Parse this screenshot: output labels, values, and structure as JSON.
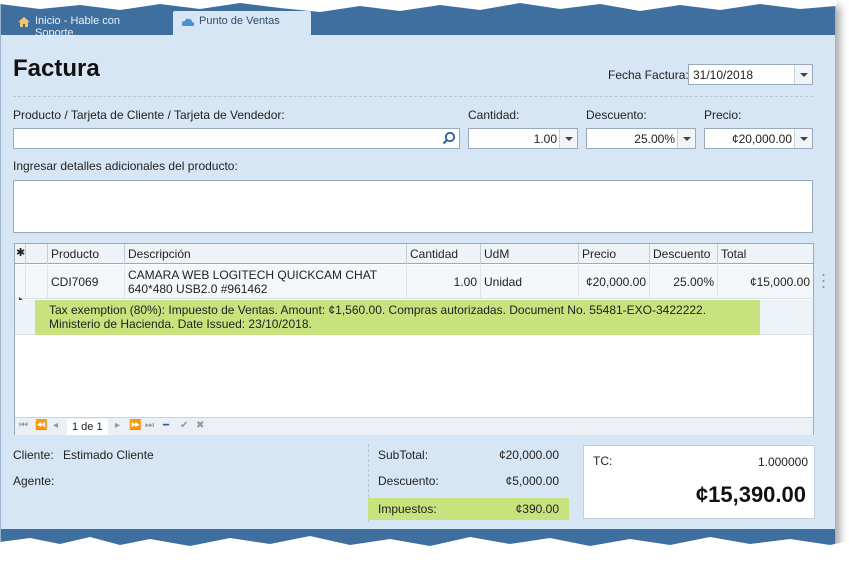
{
  "tabs": {
    "home_label": "Inicio - Hable con Soporte",
    "active_label": "Punto de Ventas"
  },
  "header": {
    "title": "Factura",
    "fecha_label": "Fecha Factura:",
    "fecha_value": "31/10/2018"
  },
  "form": {
    "producto_label": "Producto / Tarjeta de Cliente / Tarjeta de Vendedor:",
    "producto_value": "",
    "cantidad_label": "Cantidad:",
    "cantidad_value": "1.00",
    "descuento_label": "Descuento:",
    "descuento_value": "25.00%",
    "precio_label": "Precio:",
    "precio_value": "¢20,000.00",
    "detalles_label": "Ingresar detalles adicionales del producto:",
    "detalles_value": ""
  },
  "grid": {
    "corner_symbol": "✱",
    "columns": [
      "Producto",
      "Descripción",
      "Cantidad",
      "UdM",
      "Precio",
      "Descuento",
      "Total"
    ],
    "rows": [
      {
        "producto": "CDI7069",
        "descripcion": "CAMARA WEB LOGITECH QUICKCAM CHAT 640*480 USB2.0 #961462",
        "cantidad": "1.00",
        "udm": "Unidad",
        "precio": "¢20,000.00",
        "descuento": "25.00%",
        "total": "¢15,000.00",
        "detail": "Tax exemption (80%): Impuesto de Ventas. Amount: ¢1,560.00. Compras autorizadas. Document No. 55481-EXO-3422222. Ministerio de Hacienda. Date Issued: 23/10/2018."
      }
    ],
    "pager_text": "1 de 1"
  },
  "footer": {
    "cliente_label": "Cliente:",
    "cliente_value": "Estimado Cliente",
    "agente_label": "Agente:",
    "agente_value": "",
    "subtotal_label": "SubTotal:",
    "subtotal_value": "¢20,000.00",
    "descuento_label": "Descuento:",
    "descuento_value": "¢5,000.00",
    "impuestos_label": "Impuestos:",
    "impuestos_value": "¢390.00",
    "tc_label": "TC:",
    "tc_value": "1.000000",
    "grand_total": "¢15,390.00"
  },
  "colors": {
    "highlight": "#c8e27e",
    "titlebar": "#3f6f9f",
    "panel": "#d6e6f4"
  }
}
